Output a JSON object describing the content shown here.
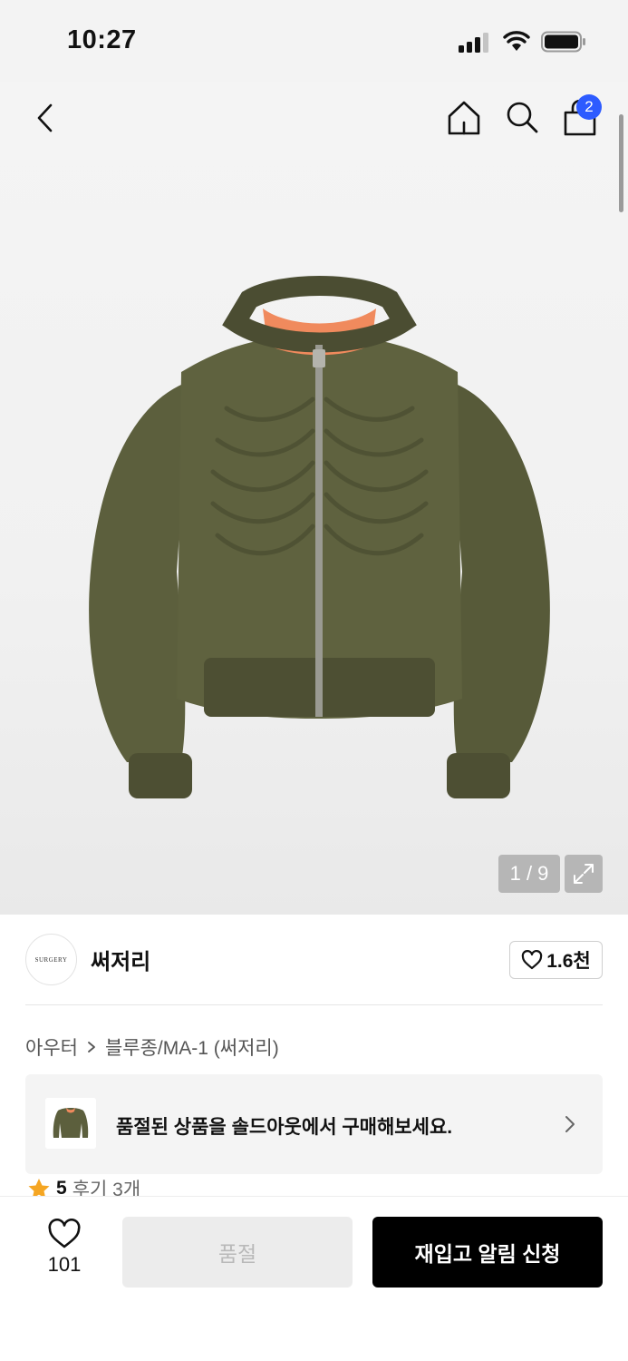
{
  "status_bar": {
    "time": "10:27"
  },
  "header": {
    "cart_count": "2"
  },
  "gallery": {
    "counter": "1 / 9"
  },
  "brand": {
    "name": "써저리",
    "logo_text": "SURGERY",
    "follow_count": "1.6천"
  },
  "breadcrumb": {
    "category": "아우터",
    "subcategory": "블루종/MA-1 (써저리)"
  },
  "soldout_banner": {
    "text": "품절된 상품을 솔드아웃에서 구매해보세요."
  },
  "rating": {
    "score": "5",
    "reviews": "후기 3개"
  },
  "bottom_bar": {
    "wish_count": "101",
    "soldout_label": "품절",
    "restock_label": "재입고 알림 신청"
  },
  "colors": {
    "accent_blue": "#2d5bff",
    "jacket_olive": "#5c5f3d",
    "lining_orange": "#f08a5d"
  },
  "icons": [
    "back-icon",
    "home-icon",
    "search-icon",
    "cart-icon",
    "expand-icon",
    "heart-icon",
    "star-icon",
    "chevron-right-icon"
  ]
}
